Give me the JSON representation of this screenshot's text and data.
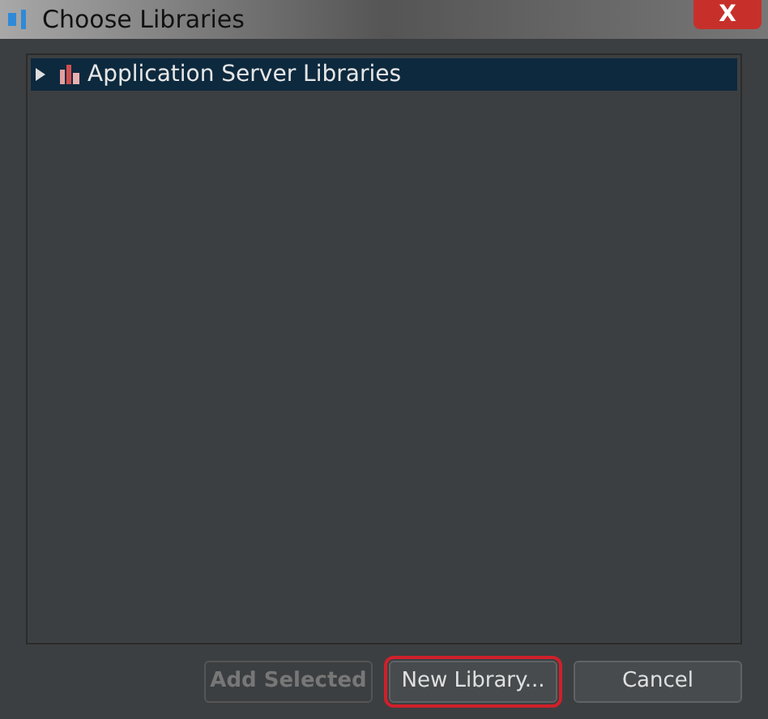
{
  "window": {
    "title": "Choose Libraries",
    "close": "X"
  },
  "tree": {
    "items": [
      {
        "label": "Application Server Libraries",
        "expanded": false,
        "selected": true
      }
    ]
  },
  "buttons": [
    {
      "label": "Add Selected",
      "disabled": true,
      "highlighted": false
    },
    {
      "label": "New Library...",
      "disabled": false,
      "highlighted": true
    },
    {
      "label": "Cancel",
      "disabled": false,
      "highlighted": false
    }
  ]
}
